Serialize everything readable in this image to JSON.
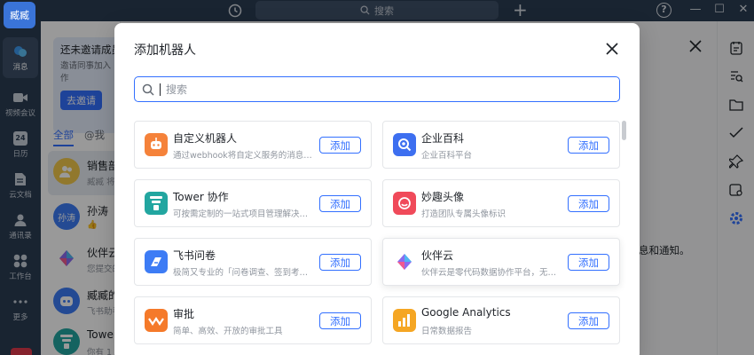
{
  "app": {
    "avatar_label": "臧臧"
  },
  "titlebar": {
    "search_placeholder": "搜索"
  },
  "nav": [
    {
      "icon": "chat-bubble-icon",
      "label": "消息"
    },
    {
      "icon": "video-icon",
      "label": "视频会议"
    },
    {
      "icon": "calendar-icon",
      "label": "日历",
      "date": "24"
    },
    {
      "icon": "document-icon",
      "label": "云文档"
    },
    {
      "icon": "contacts-icon",
      "label": "通讯录"
    },
    {
      "icon": "workspace-icon",
      "label": "工作台"
    },
    {
      "icon": "more-icon",
      "label": "更多"
    }
  ],
  "chatlist": {
    "banner_title": "还未邀请成员",
    "banner_desc_1": "邀请同事加入",
    "banner_desc_2": "作",
    "banner_button": "去邀请",
    "tabs": [
      "全部",
      "@我"
    ],
    "chats": [
      {
        "name": "销售部",
        "preview": "臧臧 将",
        "avatar": "group"
      },
      {
        "name": "孙涛",
        "preview": "👍",
        "avatar": "孙涛"
      },
      {
        "name": "伙伴云",
        "preview": "您提交的",
        "avatar": "huoban"
      },
      {
        "name": "臧臧的",
        "preview": "飞书助手",
        "avatar": "bot"
      },
      {
        "name": "Tower",
        "preview": "你有 1 个",
        "avatar": "tower"
      }
    ]
  },
  "rightpanel": {
    "notice_text": "息和通知。"
  },
  "modal": {
    "title": "添加机器人",
    "search_placeholder": "搜索",
    "bots": [
      {
        "name": "自定义机器人",
        "desc": "通过webhook将自定义服务的消息推...",
        "icon": "custom-bot-icon",
        "color": "#f5823a",
        "button": "添加"
      },
      {
        "name": "企业百科",
        "desc": "企业百科平台",
        "icon": "encyclopedia-icon",
        "color": "#3d6ff0",
        "button": "添加"
      },
      {
        "name": "Tower 协作",
        "desc": "可按需定制的一站式项目管理解决方案",
        "icon": "tower-icon",
        "color": "#22a6a0",
        "button": "添加"
      },
      {
        "name": "妙趣头像",
        "desc": "打造团队专属头像标识",
        "icon": "avatar-smile-icon",
        "color": "#f04a5a",
        "button": "添加"
      },
      {
        "name": "飞书问卷",
        "desc": "极简又专业的「问卷调查、签到考勤...",
        "icon": "survey-icon",
        "color": "#3d7cf5",
        "button": "添加"
      },
      {
        "name": "伙伴云",
        "desc": "伙伴云是零代码数据协作平台，无需...",
        "icon": "huoban-icon",
        "color": "#8a6cf0",
        "button": "添加"
      },
      {
        "name": "审批",
        "desc": "简单、高效、开放的审批工具",
        "icon": "approval-icon",
        "color": "#f57a2a",
        "button": "添加"
      },
      {
        "name": "Google Analytics",
        "desc": "日常数据报告",
        "icon": "analytics-icon",
        "color": "#f5a623",
        "button": "添加"
      }
    ]
  }
}
